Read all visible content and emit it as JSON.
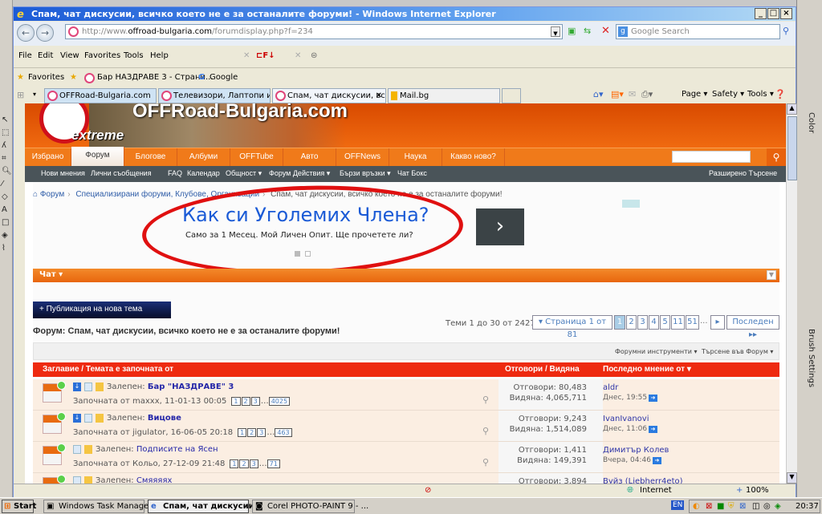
{
  "window": {
    "title": "Спам, чат дискусии, всичко което не е за останалите форуми! - Windows Internet Explorer"
  },
  "address": {
    "prefix": "http://www.",
    "domain": "offroad-bulgaria.com",
    "path": "/forumdisplay.php?f=234"
  },
  "search": {
    "placeholder": "Google Search"
  },
  "menu": [
    "File",
    "Edit",
    "View",
    "Favorites",
    "Tools",
    "Help"
  ],
  "favorites": {
    "label": "Favorites",
    "items": [
      "Бар НАЗДРАВЕ 3 - Страни...",
      "Google"
    ]
  },
  "tabs": [
    "OFFRoad-Bulgaria.com",
    "Телевизори, Лаптопи и др...",
    "Спам, чат дискусии, вс...",
    "Mail.bg"
  ],
  "commandbar": [
    "Page",
    "Safety",
    "Tools"
  ],
  "site": {
    "logo": "OFFRoad-Bulgaria.com",
    "logo_sub": "extreme",
    "nav": [
      "Избрано",
      "Форум",
      "Блогове",
      "Албуми",
      "OFFTube",
      "Авто",
      "OFFNews",
      "Наука",
      "Какво ново?"
    ],
    "subnav": [
      "Нови мнения",
      "Лични съобщения",
      "FAQ",
      "Календар",
      "Общност ▾",
      "Форум Действия ▾",
      "Бързи връзки ▾",
      "Чат Бокс"
    ],
    "advanced_search": "Разширено Търсене"
  },
  "breadcrumb": [
    "Форум",
    "Специализирани форуми, Клубове, Организации",
    "Спам, чат дискусии, всичко което не е за останалите форуми!"
  ],
  "ad": {
    "title": "Как си Уголемих Члена?",
    "subtitle": "Само за 1 Месец. Мой Личен Опит. Ще прочетете ли?",
    "arrow": "›"
  },
  "section": {
    "label": "Чат ▾"
  },
  "new_thread": "+ Публикация на нова тема",
  "forum_title": "Форум: Спам, чат дискусии, всичко което не е за останалите форуми!",
  "thread_count": "Теми 1 до 30 от 2427",
  "pagination": {
    "label": "▾ Страница 1 от 81",
    "pages": [
      "1",
      "2",
      "3",
      "4",
      "5",
      "11",
      "51"
    ],
    "ellipsis": "...",
    "next": "▸",
    "last": "Последен ▸▸",
    "current_page": 1,
    "total_pages": 81
  },
  "tools": {
    "forum_tools": "Форумни инструменти ▾",
    "search_forum": "Търсене във Форум ▾"
  },
  "table_header": {
    "title": "Заглавие / Темата е започната от",
    "stats": "Отговори / Видяна",
    "last": "Последно мнение от ▾"
  },
  "threads": [
    {
      "prefix": "Залепен:",
      "title": "Бар \"НАЗДРАВЕ\" 3",
      "starter": "Започната от maxxx, 11-01-13 00:05",
      "pages": [
        "1",
        "2",
        "3"
      ],
      "last_page": "4025",
      "replies": "Отговори: 80,483",
      "views": "Видяна: 4,065,711",
      "last_user": "aldr",
      "last_date": "Днес, 19:55"
    },
    {
      "prefix": "Залепен:",
      "title": "Вицове",
      "starter": "Започната от jigulator, 16-06-05 20:18",
      "pages": [
        "1",
        "2",
        "3"
      ],
      "last_page": "463",
      "replies": "Отговори: 9,243",
      "views": "Видяна: 1,514,089",
      "last_user": "IvanIvanovi",
      "last_date": "Днес, 11:06"
    },
    {
      "prefix": "Залепен:",
      "title": "Подписите на Ясен",
      "starter": "Започната от Кольо, 27-12-09 21:48",
      "pages": [
        "1",
        "2",
        "3"
      ],
      "last_page": "71",
      "replies": "Отговори: 1,411",
      "views": "Видяна: 149,391",
      "last_user": "Димитър Колев",
      "last_date": "Вчера, 04:46"
    },
    {
      "prefix": "Залепен:",
      "title": "Смяяяях",
      "starter": "",
      "pages": [],
      "last_page": "",
      "replies": "Отговори: 3,894",
      "views": "",
      "last_user": "Вуйз (Liebherr4eto)",
      "last_date": ""
    }
  ],
  "status": {
    "zone": "Internet",
    "zoom": "100%"
  },
  "taskbar": {
    "start": "Start",
    "items": [
      "Windows Task Manager",
      "Спам, чат дискусии, ...",
      "Corel PHOTO-PAINT 9 - ..."
    ],
    "lang": "EN",
    "time": "20:37"
  },
  "corel": {
    "dock_tabs": [
      "Color",
      "Brush Settings"
    ]
  }
}
